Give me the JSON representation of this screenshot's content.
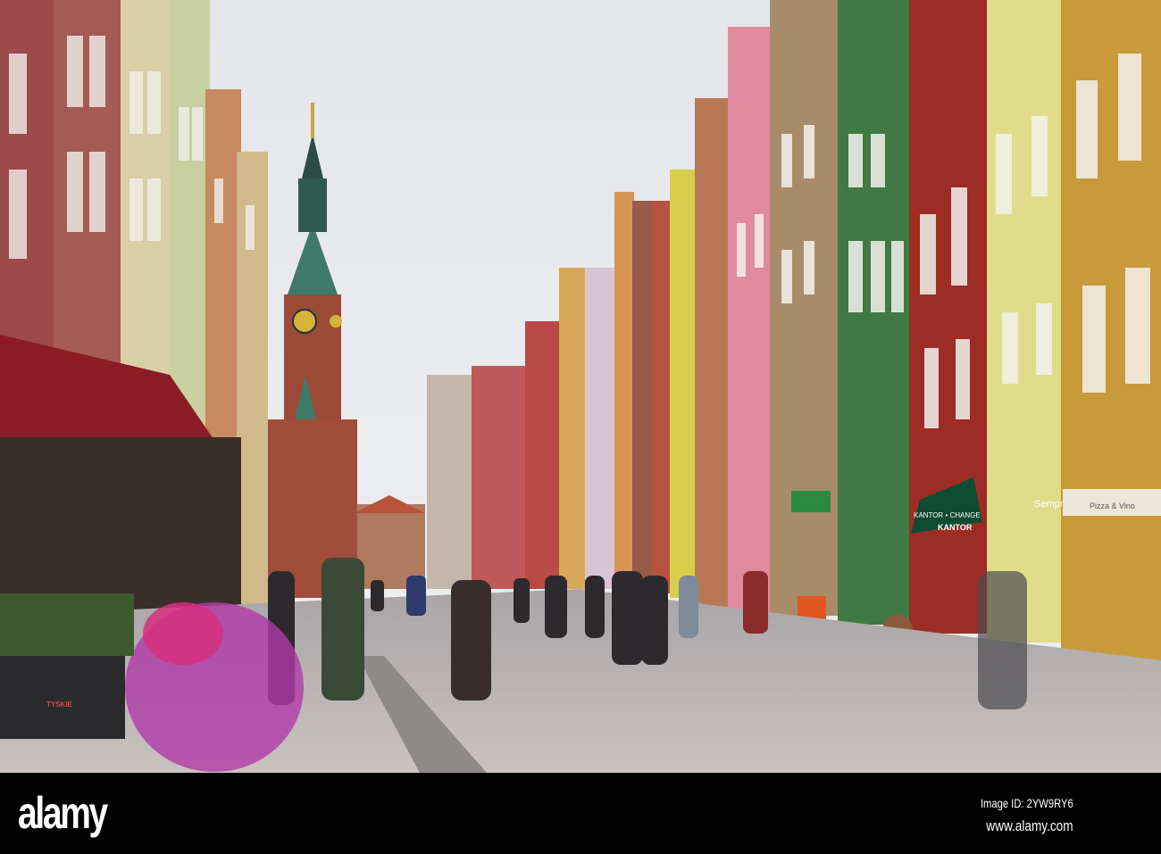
{
  "watermark": {
    "logo": "alamy",
    "image_id": "Image ID: 2YW9RY6",
    "url": "www.alamy.com"
  },
  "signs": {
    "kantor": "KANTOR",
    "kantor_awning": "KANTOR • CHANGE",
    "sempre": "Sempre",
    "pizza": "Pizza & Vino",
    "tyskie": "TYSKIE"
  },
  "colors": {
    "sky": "#e6e8ec",
    "pavement": "#b9b4b4",
    "tower_brick": "#9a4a35",
    "tower_copper": "#3f7a68",
    "awning_green": "#0f4a33",
    "awning_red": "#8b1c25"
  }
}
